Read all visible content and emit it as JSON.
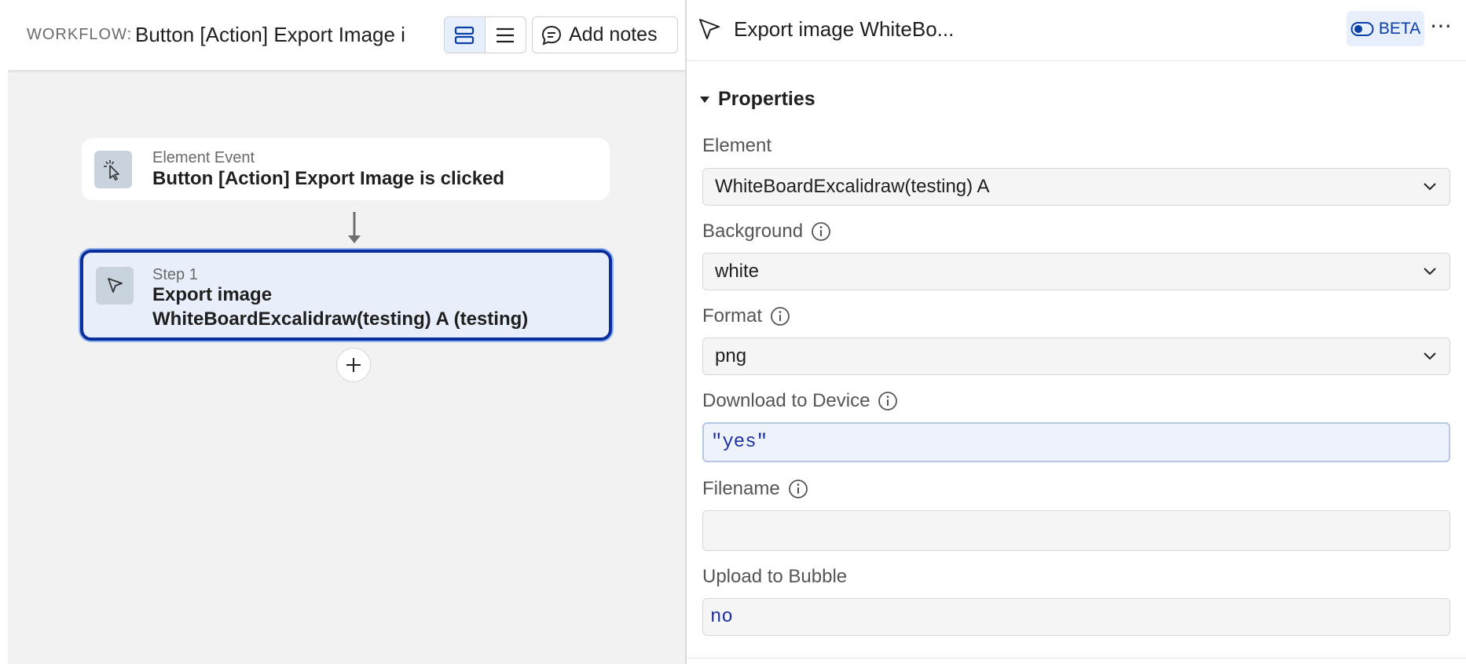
{
  "workflow": {
    "label": "WORKFLOW:",
    "name": "Button [Action] Export Image i",
    "add_notes_label": "Add notes"
  },
  "canvas": {
    "event_card": {
      "kicker": "Element Event",
      "title": "Button [Action] Export Image is clicked"
    },
    "step_card": {
      "kicker": "Step 1",
      "title_line1": "Export image",
      "title_line2": "WhiteBoardExcalidraw(testing) A (testing)"
    }
  },
  "panel": {
    "title": "Export image WhiteBo...",
    "beta_label": "BETA",
    "more_label": "⋯",
    "section_title": "Properties",
    "fields": {
      "element": {
        "label": "Element",
        "value": "WhiteBoardExcalidraw(testing) A"
      },
      "background": {
        "label": "Background",
        "value": "white"
      },
      "format": {
        "label": "Format",
        "value": "png"
      },
      "download": {
        "label": "Download to Device",
        "value": "\"yes\""
      },
      "filename": {
        "label": "Filename",
        "value": ""
      },
      "upload": {
        "label": "Upload to Bubble",
        "value": "no"
      }
    }
  },
  "colors": {
    "accent": "#0a2f9c",
    "selected_bg": "#e8effb",
    "canvas_bg": "#f2f2f2",
    "code_text": "#1a2fa0"
  }
}
